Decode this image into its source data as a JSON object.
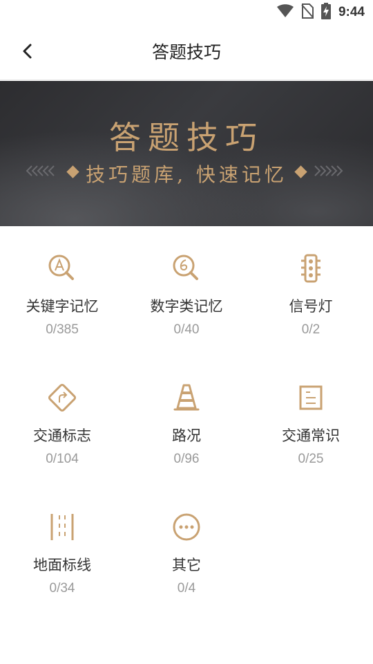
{
  "status_bar": {
    "time": "9:44",
    "icons": [
      "wifi-icon",
      "no-sim-icon",
      "battery-charging-icon"
    ]
  },
  "header": {
    "back_icon": "chevron-left-icon",
    "title": "答题技巧"
  },
  "banner": {
    "title": "答题技巧",
    "subtitle": "技巧题库, 快速记忆"
  },
  "colors": {
    "accent": "#c9a272",
    "banner_bg": "#333336",
    "label": "#333333",
    "count": "#999999"
  },
  "categories": [
    {
      "label": "关键字记忆",
      "count": "0/385",
      "icon": "letter-a-search-icon"
    },
    {
      "label": "数字类记忆",
      "count": "0/40",
      "icon": "number-six-search-icon"
    },
    {
      "label": "信号灯",
      "count": "0/2",
      "icon": "traffic-light-icon"
    },
    {
      "label": "交通标志",
      "count": "0/104",
      "icon": "turn-sign-icon"
    },
    {
      "label": "路况",
      "count": "0/96",
      "icon": "traffic-cone-icon"
    },
    {
      "label": "交通常识",
      "count": "0/25",
      "icon": "document-icon"
    },
    {
      "label": "地面标线",
      "count": "0/34",
      "icon": "lane-markings-icon"
    },
    {
      "label": "其它",
      "count": "0/4",
      "icon": "more-dots-icon"
    }
  ]
}
